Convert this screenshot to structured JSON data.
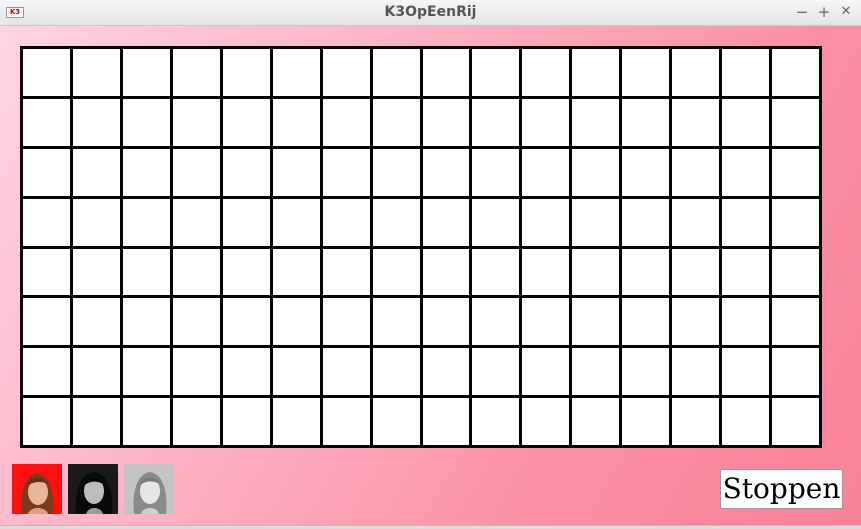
{
  "window": {
    "title": "K3OpEenRij",
    "icon_text": "K3",
    "minimize_glyph": "−",
    "maximize_glyph": "+",
    "close_glyph": "✕"
  },
  "board": {
    "columns": 16,
    "rows": 8,
    "cells_filled": 0
  },
  "players": [
    {
      "name": "player-1-portrait",
      "background": "#ff0000",
      "selected": true
    },
    {
      "name": "player-2-portrait",
      "background": "#1a1a1a",
      "selected": false
    },
    {
      "name": "player-3-portrait",
      "background": "#bdbdbd",
      "selected": false
    }
  ],
  "controls": {
    "stop_label": "Stoppen"
  },
  "colors": {
    "background_start": "#ffd4e4",
    "background_end": "#fa8298",
    "grid_line": "#000000",
    "cell": "#ffffff"
  }
}
